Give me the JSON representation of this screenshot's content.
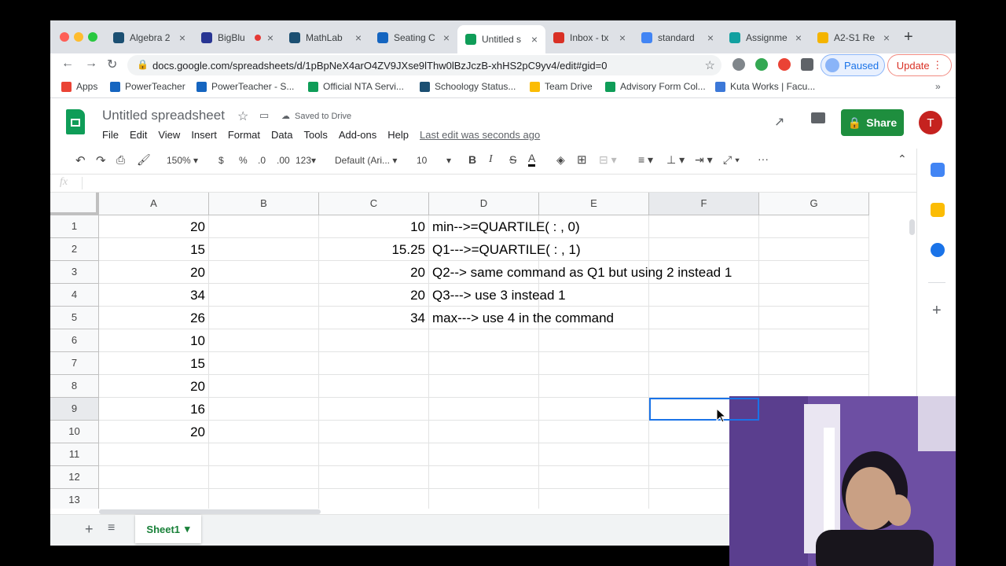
{
  "browser": {
    "tabs": [
      {
        "label": "Algebra 2",
        "icon": "schoology-icon",
        "color": "#1b4f72"
      },
      {
        "label": "BigBlu",
        "icon": "bigbluebutton-icon",
        "color": "#283593",
        "recording": true
      },
      {
        "label": "MathLab",
        "icon": "schoology-icon",
        "color": "#1b4f72"
      },
      {
        "label": "Seating C",
        "icon": "sis-icon",
        "color": "#1565c0"
      },
      {
        "label": "Untitled s",
        "icon": "sheets-icon",
        "color": "#0f9d58",
        "active": true
      },
      {
        "label": "Inbox - tx",
        "icon": "gmail-icon",
        "color": "#d93025"
      },
      {
        "label": "standard",
        "icon": "docs-icon",
        "color": "#4285f4"
      },
      {
        "label": "Assignme",
        "icon": "assignment-icon",
        "color": "#12a0a0"
      },
      {
        "label": "A2-S1 Re",
        "icon": "slides-icon",
        "color": "#f4b400"
      }
    ],
    "url": "docs.google.com/spreadsheets/d/1pBpNeX4arO4ZV9JXse9lThw0lBzJczB-xhHS2pC9yv4/edit#gid=0",
    "profile_status": "Paused",
    "update_label": "Update",
    "bookmarks": [
      {
        "label": "Apps",
        "icon": "apps-grid-icon"
      },
      {
        "label": "PowerTeacher",
        "icon": "sis-icon"
      },
      {
        "label": "PowerTeacher - S...",
        "icon": "sis-icon"
      },
      {
        "label": "Official NTA Servi...",
        "icon": "sheets-icon"
      },
      {
        "label": "Schoology Status...",
        "icon": "schoology-icon"
      },
      {
        "label": "Team Drive",
        "icon": "drive-icon"
      },
      {
        "label": "Advisory Form Col...",
        "icon": "sheets-icon"
      },
      {
        "label": "Kuta Works | Facu...",
        "icon": "kuta-icon"
      }
    ],
    "bookmarks_more": "»"
  },
  "sheets": {
    "title": "Untitled spreadsheet",
    "saved_status": "Saved to Drive",
    "menu": [
      "File",
      "Edit",
      "View",
      "Insert",
      "Format",
      "Data",
      "Tools",
      "Add-ons",
      "Help"
    ],
    "last_edit": "Last edit was seconds ago",
    "share_label": "Share",
    "account_initial": "T",
    "toolbar": {
      "zoom": "150%",
      "currency": "$",
      "percent": "%",
      "dec_decrease": ".0",
      "dec_increase": ".00",
      "more_formats": "123",
      "font": "Default (Ari...",
      "font_size": "10",
      "bold": "B",
      "italic": "I",
      "strike": "S",
      "text_color": "A",
      "more": "···"
    },
    "fx_label": "fx",
    "columns": [
      "A",
      "B",
      "C",
      "D",
      "E",
      "F",
      "G"
    ],
    "rows": [
      "1",
      "2",
      "3",
      "4",
      "5",
      "6",
      "7",
      "8",
      "9",
      "10",
      "11",
      "12",
      "13"
    ],
    "col_a": [
      "20",
      "15",
      "20",
      "34",
      "26",
      "10",
      "15",
      "20",
      "16",
      "20"
    ],
    "col_c": [
      "10",
      "15.25",
      "20",
      "20",
      "34"
    ],
    "col_d": [
      "min-->=QUARTILE( :  , 0)",
      "Q1--->=QUARTILE( : , 1)",
      "Q2--> same command as Q1 but using 2 instead 1",
      "Q3---> use 3 instead 1",
      "max---> use 4 in the command"
    ],
    "sheet_tab": "Sheet1",
    "selected_cell": "F9"
  }
}
